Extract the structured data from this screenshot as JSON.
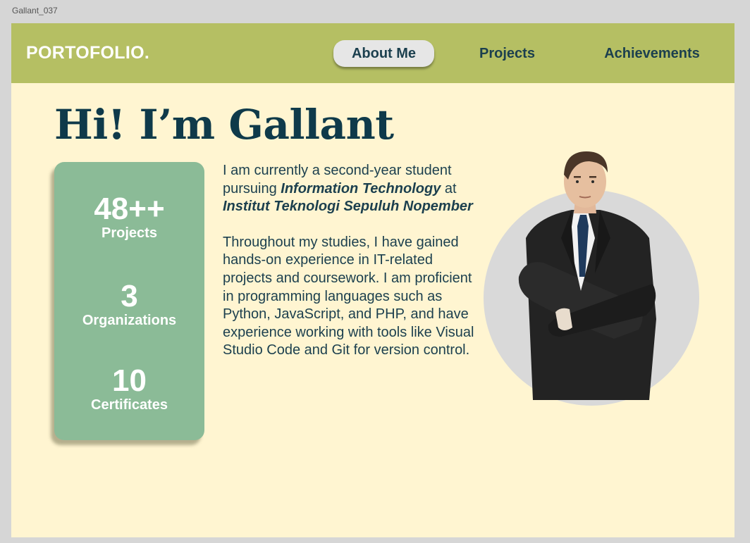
{
  "frame": {
    "label": "Gallant_037"
  },
  "nav": {
    "brand": "PORTOFOLIO.",
    "items": [
      {
        "label": "About Me",
        "active": true
      },
      {
        "label": "Projects",
        "active": false
      },
      {
        "label": "Achievements",
        "active": false
      }
    ]
  },
  "hero": {
    "title": "Hi! I’m Gallant"
  },
  "stats": [
    {
      "value": "48++",
      "label": "Projects"
    },
    {
      "value": "3",
      "label": "Organizations"
    },
    {
      "value": "10",
      "label": "Certificates"
    }
  ],
  "bio": {
    "p1_a": "I am currently a second-year student pursuing ",
    "p1_major": "Information Technology",
    "p1_b": " at ",
    "p1_school": "Institut Teknologi Sepuluh Nopember",
    "p2": "Throughout my studies, I have gained hands-on experience in IT-related projects and coursework. I am proficient in programming languages such as Python, JavaScript, and PHP, and have experience working with tools like Visual Studio Code and Git for version control."
  },
  "colors": {
    "page_bg": "#fff5d1",
    "nav_bg": "#b5bf63",
    "text_dark": "#1b3f4e",
    "card_green": "#8bbb97",
    "active_pill": "#e6e6e6"
  },
  "photo": {
    "icon": "profile-photo"
  }
}
